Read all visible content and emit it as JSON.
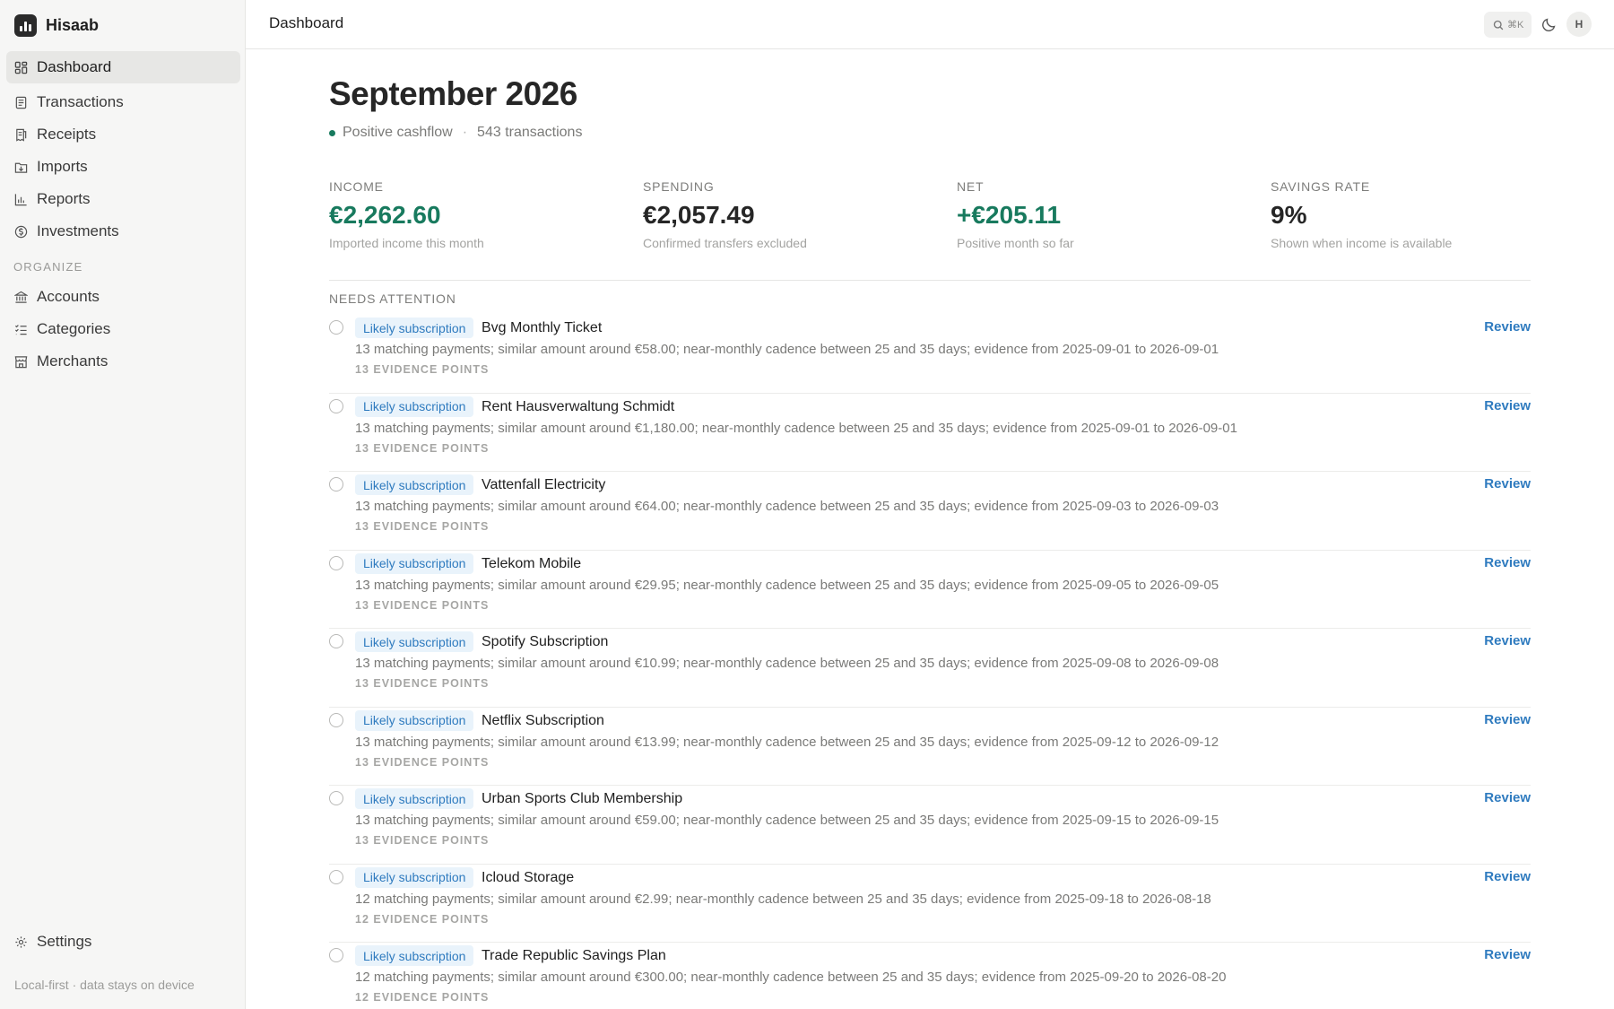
{
  "app": {
    "name": "Hisaab"
  },
  "sidebar": {
    "items": [
      {
        "label": "Dashboard",
        "icon": "dashboard-icon",
        "active": true
      },
      {
        "label": "Transactions",
        "icon": "document-icon"
      },
      {
        "label": "Receipts",
        "icon": "receipt-icon"
      },
      {
        "label": "Imports",
        "icon": "folder-import-icon"
      },
      {
        "label": "Reports",
        "icon": "bar-chart-icon"
      },
      {
        "label": "Investments",
        "icon": "coin-icon"
      }
    ],
    "organize_label": "ORGANIZE",
    "organize_items": [
      {
        "label": "Accounts",
        "icon": "bank-icon"
      },
      {
        "label": "Categories",
        "icon": "checklist-icon"
      },
      {
        "label": "Merchants",
        "icon": "store-icon"
      }
    ],
    "settings_label": "Settings",
    "footer_note": "Local-first · data stays on device"
  },
  "topbar": {
    "title": "Dashboard",
    "search_shortcut": "⌘K",
    "avatar_initial": "H"
  },
  "page": {
    "title": "September 2026",
    "status": "Positive cashflow",
    "separator": "·",
    "transactions": "543 transactions"
  },
  "stats": [
    {
      "label": "INCOME",
      "value": "€2,262.60",
      "note": "Imported income this month",
      "color": "#187a5e"
    },
    {
      "label": "SPENDING",
      "value": "€2,057.49",
      "note": "Confirmed transfers excluded",
      "color": "#262626"
    },
    {
      "label": "NET",
      "value": "+€205.11",
      "note": "Positive month so far",
      "color": "#187a5e"
    },
    {
      "label": "SAVINGS RATE",
      "value": "9%",
      "note": "Shown when income is available",
      "color": "#262626"
    }
  ],
  "attention": {
    "label": "NEEDS ATTENTION",
    "badge": "Likely subscription",
    "action": "Review",
    "items": [
      {
        "merchant": "Bvg Monthly Ticket",
        "detail": "13 matching payments; similar amount around €58.00; near-monthly cadence between 25 and 35 days; evidence from 2025-09-01 to 2026-09-01",
        "evidence": "13 EVIDENCE POINTS"
      },
      {
        "merchant": "Rent Hausverwaltung Schmidt",
        "detail": "13 matching payments; similar amount around €1,180.00; near-monthly cadence between 25 and 35 days; evidence from 2025-09-01 to 2026-09-01",
        "evidence": "13 EVIDENCE POINTS"
      },
      {
        "merchant": "Vattenfall Electricity",
        "detail": "13 matching payments; similar amount around €64.00; near-monthly cadence between 25 and 35 days; evidence from 2025-09-03 to 2026-09-03",
        "evidence": "13 EVIDENCE POINTS"
      },
      {
        "merchant": "Telekom Mobile",
        "detail": "13 matching payments; similar amount around €29.95; near-monthly cadence between 25 and 35 days; evidence from 2025-09-05 to 2026-09-05",
        "evidence": "13 EVIDENCE POINTS"
      },
      {
        "merchant": "Spotify Subscription",
        "detail": "13 matching payments; similar amount around €10.99; near-monthly cadence between 25 and 35 days; evidence from 2025-09-08 to 2026-09-08",
        "evidence": "13 EVIDENCE POINTS"
      },
      {
        "merchant": "Netflix Subscription",
        "detail": "13 matching payments; similar amount around €13.99; near-monthly cadence between 25 and 35 days; evidence from 2025-09-12 to 2026-09-12",
        "evidence": "13 EVIDENCE POINTS"
      },
      {
        "merchant": "Urban Sports Club Membership",
        "detail": "13 matching payments; similar amount around €59.00; near-monthly cadence between 25 and 35 days; evidence from 2025-09-15 to 2026-09-15",
        "evidence": "13 EVIDENCE POINTS"
      },
      {
        "merchant": "Icloud Storage",
        "detail": "12 matching payments; similar amount around €2.99; near-monthly cadence between 25 and 35 days; evidence from 2025-09-18 to 2026-08-18",
        "evidence": "12 EVIDENCE POINTS"
      },
      {
        "merchant": "Trade Republic Savings Plan",
        "detail": "12 matching payments; similar amount around €300.00; near-monthly cadence between 25 and 35 days; evidence from 2025-09-20 to 2026-08-20",
        "evidence": "12 EVIDENCE POINTS"
      }
    ]
  }
}
